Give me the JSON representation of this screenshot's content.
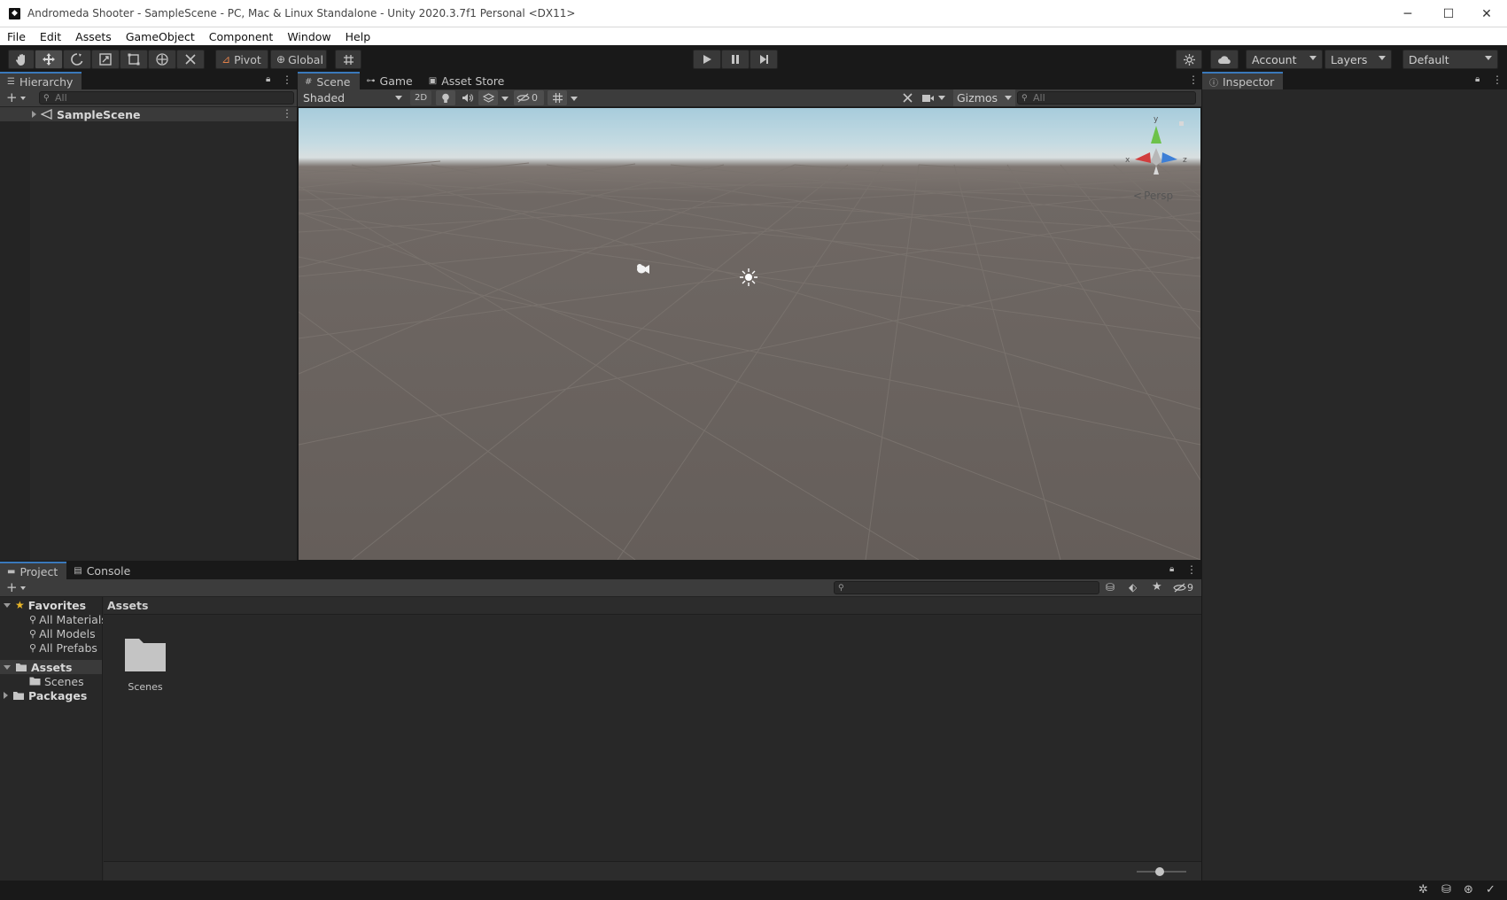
{
  "window": {
    "title": "Andromeda Shooter - SampleScene - PC, Mac & Linux Standalone - Unity 2020.3.7f1 Personal <DX11>",
    "controls": {
      "minimize": "─",
      "maximize": "☐",
      "close": "✕"
    }
  },
  "menu": [
    "File",
    "Edit",
    "Assets",
    "GameObject",
    "Component",
    "Window",
    "Help"
  ],
  "toolbar": {
    "pivot_label": "Pivot",
    "global_label": "Global",
    "account_label": "Account",
    "layers_label": "Layers",
    "layout_label": "Default"
  },
  "hierarchy": {
    "tab_label": "Hierarchy",
    "search_placeholder": "All",
    "scene_name": "SampleScene"
  },
  "scene_tabs": [
    "Scene",
    "Game",
    "Asset Store"
  ],
  "scene_toolbar": {
    "shading_mode": "Shaded",
    "mode_2d": "2D",
    "hidden_count": "0",
    "gizmos_label": "Gizmos",
    "search_placeholder": "All"
  },
  "scene_gizmo": {
    "axis_x": "x",
    "axis_y": "y",
    "axis_z": "z",
    "projection": "Persp",
    "colors": {
      "x": "#d13d3d",
      "y": "#6cc24a",
      "z": "#3d7fd6"
    }
  },
  "inspector": {
    "tab_label": "Inspector"
  },
  "project_tabs": [
    "Project",
    "Console"
  ],
  "project": {
    "hidden_count": "9",
    "favorites_label": "Favorites",
    "favorites": [
      "All Materials",
      "All Models",
      "All Prefabs"
    ],
    "assets_label": "Assets",
    "assets_children": [
      "Scenes"
    ],
    "packages_label": "Packages",
    "breadcrumb": "Assets",
    "grid_items": [
      {
        "name": "Scenes",
        "icon": "folder-icon"
      }
    ],
    "zoom_slider": 0.45
  },
  "colors": {
    "accent": "#3a79bb",
    "panel": "#282828",
    "toolbar": "#191919"
  }
}
